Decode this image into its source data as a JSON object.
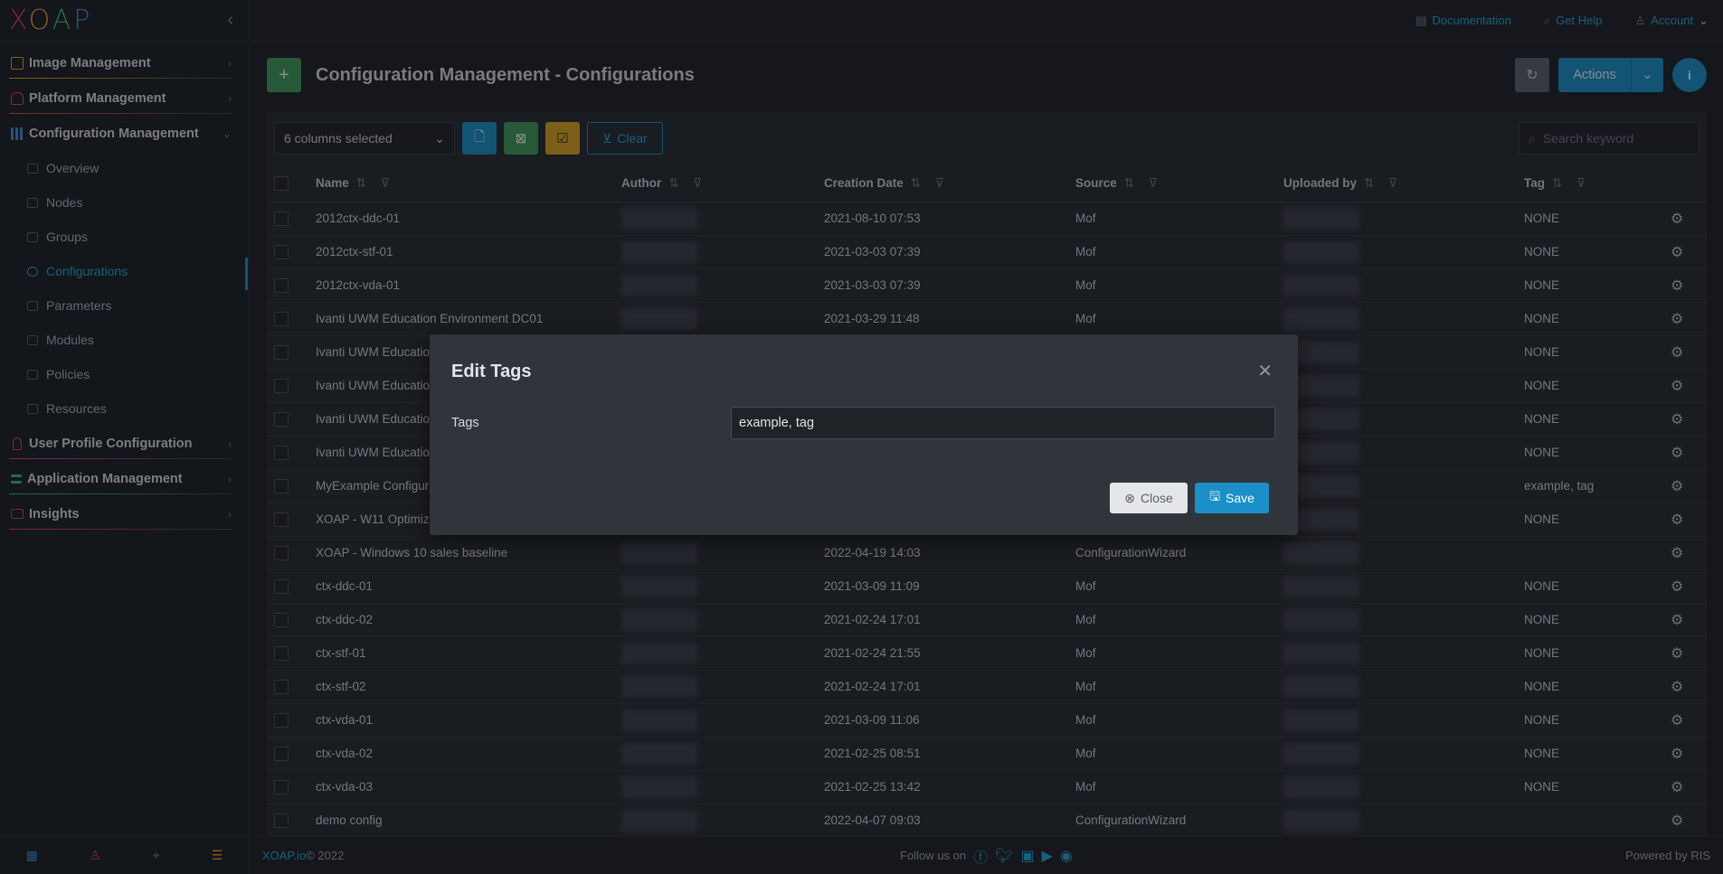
{
  "logo": {
    "letters": [
      "X",
      "O",
      "A",
      "P"
    ]
  },
  "sidebar": {
    "groups": [
      {
        "label": "Image Management",
        "color": "#f0a020"
      },
      {
        "label": "Platform Management",
        "color": "#e2503a"
      },
      {
        "label": "Configuration Management",
        "color": "#3b8fd8"
      },
      {
        "label": "User Profile Configuration",
        "color": "#e23a9a"
      },
      {
        "label": "Application Management",
        "color": "#3cb878"
      },
      {
        "label": "Insights",
        "color": "#e23a5a"
      }
    ],
    "config_items": [
      "Overview",
      "Nodes",
      "Groups",
      "Configurations",
      "Parameters",
      "Modules",
      "Policies",
      "Resources"
    ],
    "active_item": "Configurations"
  },
  "topbar": {
    "documentation": "Documentation",
    "help": "Get Help",
    "account": "Account"
  },
  "header": {
    "title": "Configuration Management - Configurations",
    "actions_label": "Actions",
    "add_symbol": "+",
    "info_symbol": "i"
  },
  "toolbar": {
    "columns_selected": "6 columns selected",
    "clear_label": "Clear",
    "search_placeholder": "Search keyword"
  },
  "table": {
    "columns": [
      "Name",
      "Author",
      "Creation Date",
      "Source",
      "Uploaded by",
      "Tag"
    ],
    "rows": [
      {
        "name": "2012ctx-ddc-01",
        "date": "2021-08-10 07:53",
        "source": "Mof",
        "tag": "NONE"
      },
      {
        "name": "2012ctx-stf-01",
        "date": "2021-03-03 07:39",
        "source": "Mof",
        "tag": "NONE"
      },
      {
        "name": "2012ctx-vda-01",
        "date": "2021-03-03 07:39",
        "source": "Mof",
        "tag": "NONE"
      },
      {
        "name": "Ivanti UWM Education Environment DC01",
        "date": "2021-03-29 11:48",
        "source": "Mof",
        "tag": "NONE"
      },
      {
        "name": "Ivanti UWM Educatio",
        "date": "",
        "source": "",
        "tag": "NONE"
      },
      {
        "name": "Ivanti UWM Educatio",
        "date": "",
        "source": "",
        "tag": "NONE"
      },
      {
        "name": "Ivanti UWM Educatio",
        "date": "",
        "source": "",
        "tag": "NONE"
      },
      {
        "name": "Ivanti UWM Educatio",
        "date": "",
        "source": "",
        "tag": "NONE"
      },
      {
        "name": "MyExample Configura",
        "date": "",
        "source": "",
        "tag": "example, tag"
      },
      {
        "name": "XOAP - W11 Optimiz",
        "date": "",
        "source": "",
        "tag": "NONE"
      },
      {
        "name": "XOAP - Windows 10 sales baseline",
        "date": "2022-04-19 14:03",
        "source": "ConfigurationWizard",
        "tag": ""
      },
      {
        "name": "ctx-ddc-01",
        "date": "2021-03-09 11:09",
        "source": "Mof",
        "tag": "NONE"
      },
      {
        "name": "ctx-ddc-02",
        "date": "2021-02-24 17:01",
        "source": "Mof",
        "tag": "NONE"
      },
      {
        "name": "ctx-stf-01",
        "date": "2021-02-24 21:55",
        "source": "Mof",
        "tag": "NONE"
      },
      {
        "name": "ctx-stf-02",
        "date": "2021-02-24 17:01",
        "source": "Mof",
        "tag": "NONE"
      },
      {
        "name": "ctx-vda-01",
        "date": "2021-03-09 11:06",
        "source": "Mof",
        "tag": "NONE"
      },
      {
        "name": "ctx-vda-02",
        "date": "2021-02-25 08:51",
        "source": "Mof",
        "tag": "NONE"
      },
      {
        "name": "ctx-vda-03",
        "date": "2021-02-25 13:42",
        "source": "Mof",
        "tag": "NONE"
      },
      {
        "name": "demo config",
        "date": "2022-04-07 09:03",
        "source": "ConfigurationWizard",
        "tag": ""
      }
    ]
  },
  "modal": {
    "title": "Edit Tags",
    "field_label": "Tags",
    "field_value": "example, tag",
    "close_label": "Close",
    "save_label": "Save"
  },
  "footer": {
    "brand": "XOAP.io",
    "copyright": " © 2022",
    "follow": "Follow us on",
    "powered": "Powered by RIS"
  }
}
